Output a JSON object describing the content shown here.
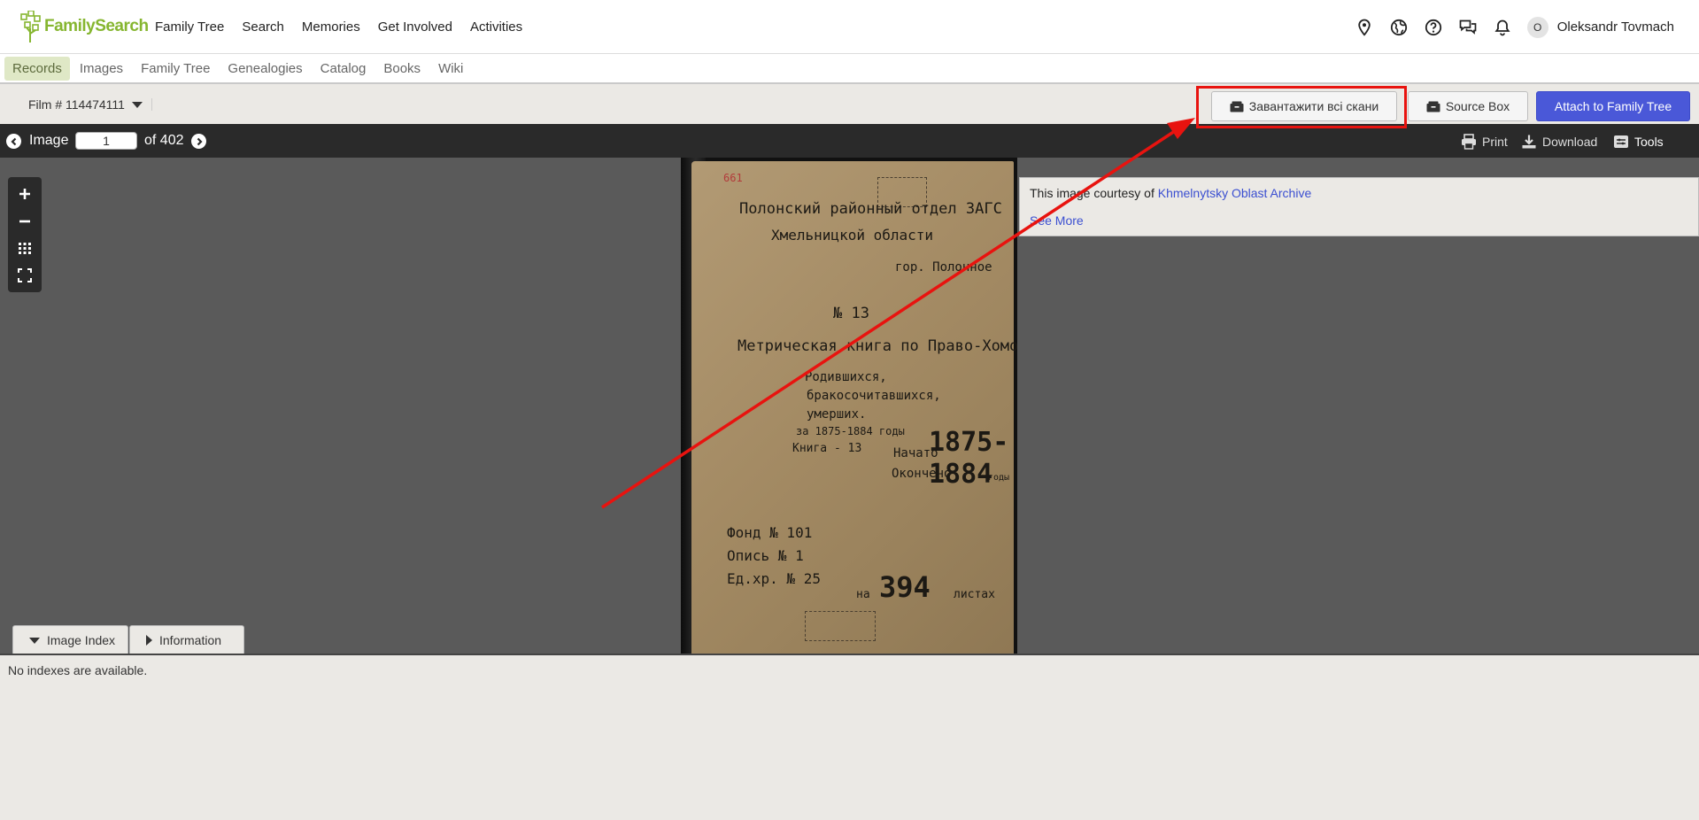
{
  "header": {
    "logo_text": "FamilySearch",
    "nav": [
      "Family Tree",
      "Search",
      "Memories",
      "Get Involved",
      "Activities"
    ],
    "icons": [
      "location-pin-icon",
      "globe-icon",
      "help-icon",
      "chat-icon",
      "bell-icon"
    ],
    "avatar_initial": "O",
    "user_name": "Oleksandr Tovmach"
  },
  "subnav": {
    "items": [
      "Records",
      "Images",
      "Family Tree",
      "Genealogies",
      "Catalog",
      "Books",
      "Wiki"
    ],
    "active": "Records"
  },
  "filmbar": {
    "film_label": "Film # 114474111",
    "download_all_label": "Завантажити всі скани",
    "source_box_label": "Source Box",
    "attach_label": "Attach to Family Tree",
    "accent_color": "#4a58d8",
    "highlight_color": "#e8130f"
  },
  "imagebar": {
    "image_label": "Image",
    "current_image": "1",
    "of_label": "of 402",
    "print_label": "Print",
    "download_label": "Download",
    "tools_label": "Tools"
  },
  "courtesy": {
    "text": "This image courtesy of",
    "archive": "Khmelnytsky Oblast Archive",
    "see_more": "See More"
  },
  "document": {
    "lines": [
      "661",
      "Полонский районный отдел ЗАГС",
      "Хмельницкой области",
      "гор. Полонное",
      "№ 13",
      "Метрическая книга по Право-Хоморное",
      "Родившихся,",
      "бракосочитавшихся,",
      "умерших.",
      "за 1875-1884 годы",
      "Книга - 13",
      "Начато",
      "Окончено",
      "1875-",
      "1884",
      "годы",
      "Фонд № 101",
      "Опись № 1",
      "Ед.хр. № 25",
      "на",
      "394",
      "листах"
    ]
  },
  "tabs": {
    "image_index": "Image Index",
    "information": "Information"
  },
  "bottom": {
    "message": "No indexes are available."
  }
}
